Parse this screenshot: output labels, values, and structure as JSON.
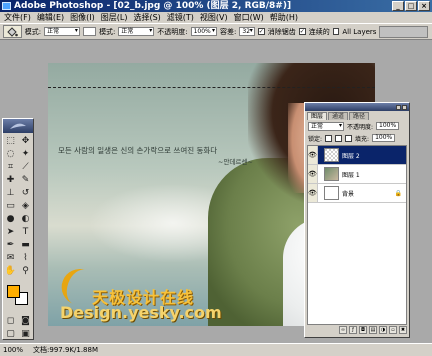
{
  "window": {
    "title": "Adobe Photoshop - [02_b.jpg @ 100% (图层 2, RGB/8#)]",
    "min_label": "_",
    "max_label": "□",
    "close_label": "×"
  },
  "menu": [
    "文件(F)",
    "编辑(E)",
    "图像(I)",
    "图层(L)",
    "选择(S)",
    "滤镜(T)",
    "视图(V)",
    "窗口(W)",
    "帮助(H)"
  ],
  "options": {
    "mode_label": "模式:",
    "mode_value": "正常",
    "mode2_label": "模式:",
    "mode2_value": "正常",
    "opacity_label": "不透明度:",
    "opacity_value": "100%",
    "tolerance_label": "容差:",
    "tolerance_value": "32",
    "antialias_label": "消除锯齿",
    "contiguous_label": "连续的",
    "all_layers_label": "All Layers"
  },
  "document": {
    "caption": "모든 사람의 일생은 신의 손가락으로 쓰여진 동화다",
    "caption_author": "~안데르센~",
    "watermark_cn": "天极设计在线",
    "watermark_en": "Design.yesky.com"
  },
  "status": {
    "zoom": "100%",
    "doc_info": "文档:997.9K/1.88M"
  },
  "layers_panel": {
    "tab_layers": "图层",
    "tab_channels": "通道",
    "tab_paths": "路径",
    "blend_mode": "正常",
    "opacity_label": "不透明度:",
    "opacity_value": "100%",
    "lock_label": "锁定:",
    "fill_label": "填充:",
    "fill_value": "100%",
    "layers": [
      {
        "name": "图层 2",
        "selected": true
      },
      {
        "name": "图层 1",
        "selected": false
      },
      {
        "name": "背景",
        "selected": false
      }
    ]
  },
  "colors": {
    "foreground": "#ffae00",
    "background": "#ffffff",
    "title_bar": "#0a246a",
    "selected_layer": "#0a246a"
  }
}
